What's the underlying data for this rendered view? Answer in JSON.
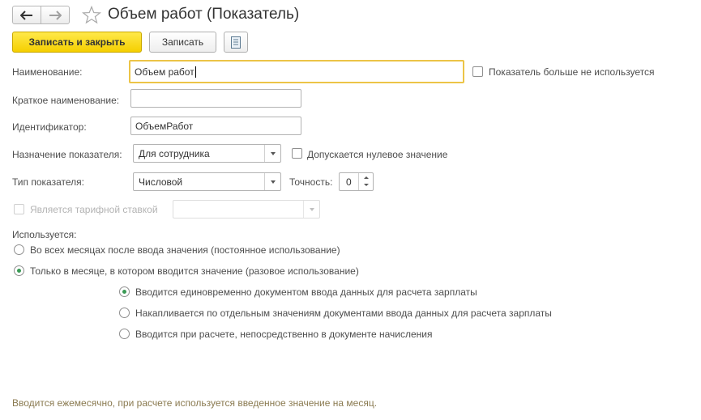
{
  "header": {
    "title": "Объем работ (Показатель)",
    "back_icon": "arrow-left-icon",
    "forward_icon": "arrow-right-icon",
    "favorite_icon": "star-icon"
  },
  "toolbar": {
    "save_close_label": "Записать и закрыть",
    "save_label": "Записать",
    "more_icon": "document-list-icon"
  },
  "form": {
    "name_label": "Наименование:",
    "name_value": "Объем работ",
    "unused_label": "Показатель больше не используется",
    "short_name_label": "Краткое наименование:",
    "short_name_value": "",
    "identifier_label": "Идентификатор:",
    "identifier_value": "ОбъемРабот",
    "purpose_label": "Назначение показателя:",
    "purpose_value": "Для сотрудника",
    "zero_allowed_label": "Допускается нулевое значение",
    "type_label": "Тип показателя:",
    "type_value": "Числовой",
    "precision_label": "Точность:",
    "precision_value": "0",
    "tariff_label": "Является тарифной ставкой",
    "tariff_value": ""
  },
  "usage": {
    "label": "Используется:",
    "options": [
      "Во всех месяцах после ввода значения (постоянное использование)",
      "Только в месяце, в котором вводится значение (разовое использование)"
    ],
    "sub_options": [
      "Вводится единовременно документом ввода данных для расчета зарплаты",
      "Накапливается по отдельным значениям документами ввода данных для расчета зарплаты",
      "Вводится при расчете, непосредственно в документе начисления"
    ]
  },
  "footer": {
    "hint": "Вводится ежемесячно, при расчете используется введенное значение на месяц."
  },
  "colors": {
    "accent_yellow": "#f5cf00",
    "focus_border": "#ecc447",
    "radio_selected": "#3a9a55",
    "hint_text": "#8a7a50"
  }
}
